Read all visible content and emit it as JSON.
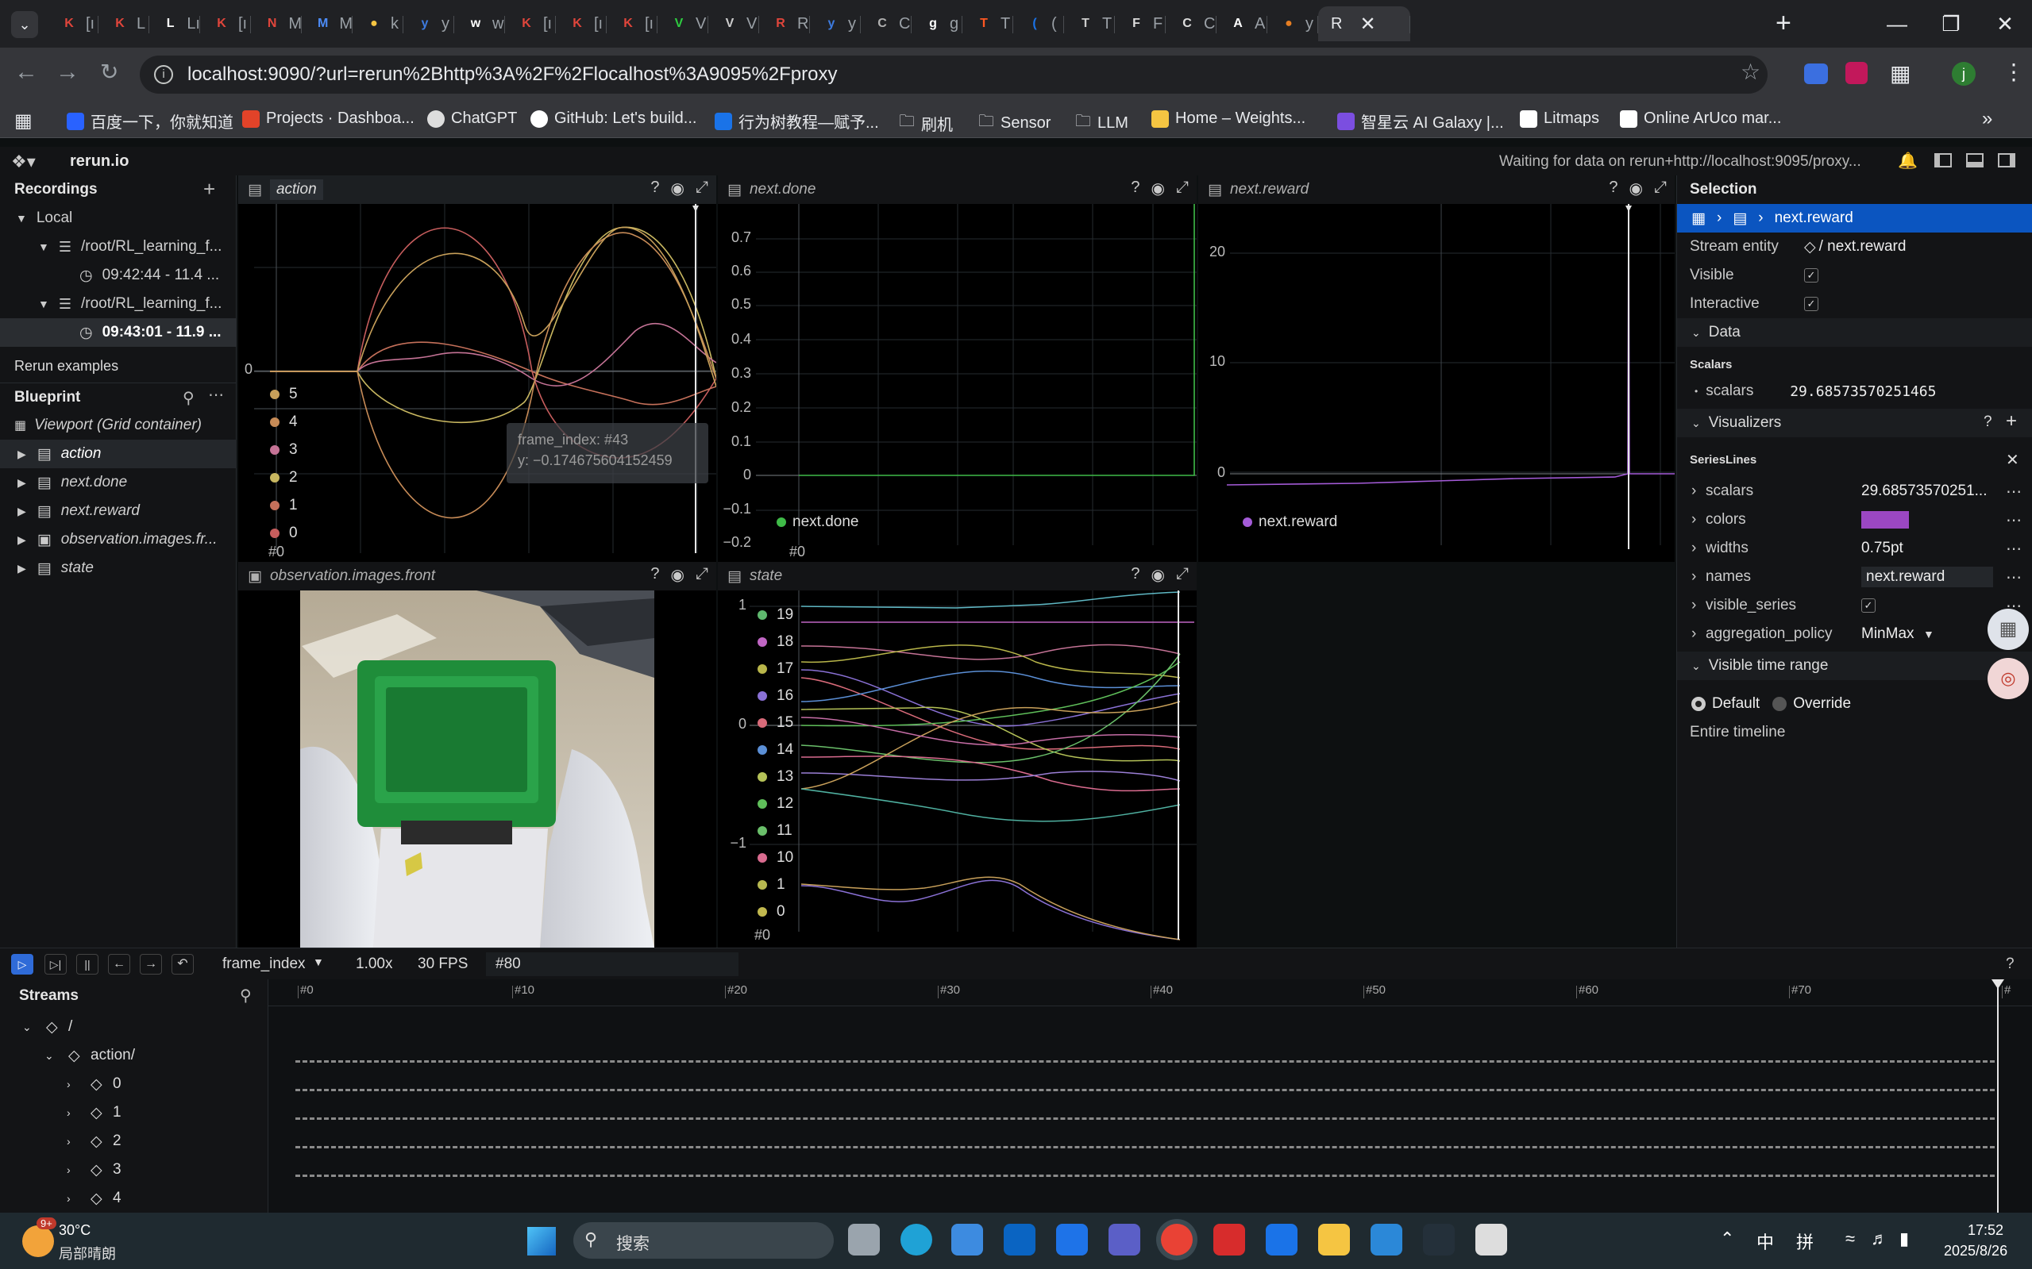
{
  "browser": {
    "tab_glyphs": [
      "K",
      "K",
      "L",
      "K",
      "N",
      "M",
      "●",
      "y",
      "w",
      "K",
      "K",
      "K",
      "V",
      "V",
      "R",
      "y",
      "C",
      "g",
      "T",
      "(",
      "T",
      "F",
      "C",
      "A",
      "●"
    ],
    "tab_titles": [
      "[ı",
      "L",
      "Lı",
      "[ı",
      "M",
      "M",
      "k",
      "y",
      "w",
      "[ı",
      "[ı",
      "[ı",
      "V",
      "V",
      "R",
      "y",
      "C",
      "g",
      "T",
      "(",
      "T",
      "F",
      "C",
      "A",
      "y"
    ],
    "tab_colors": [
      "#e0453b",
      "#e0453b",
      "#ffffff",
      "#e0453b",
      "#e0453b",
      "#4c8bf5",
      "#f5c542",
      "#3d7be0",
      "#ffffff",
      "#e0453b",
      "#e0453b",
      "#e0453b",
      "#2ecc40",
      "#cccccc",
      "#e0453b",
      "#3d7be0",
      "#b0b0b0",
      "#ffffff",
      "#ff5722",
      "#1a73e8",
      "#cccccc",
      "#dddddd",
      "#dddddd",
      "#ffffff",
      "#e67e22"
    ],
    "active_tab_title": "R",
    "url": "localhost:9090/?url=rerun%2Bhttp%3A%2F%2Flocalhost%3A9095%2Fproxy",
    "profile_initial": "j",
    "bookmarks": [
      "百度一下，你就知道",
      "Projects · Dashboa...",
      "ChatGPT",
      "GitHub: Let's build...",
      "行为树教程—赋予...",
      "刷机",
      "Sensor",
      "LLM",
      "Home – Weights...",
      "智星云 AI Galaxy |...",
      "Litmaps",
      "Online ArUco mar..."
    ]
  },
  "app": {
    "brand": "rerun.io",
    "status": "Waiting for data on rerun+http://localhost:9095/proxy..."
  },
  "recordings": {
    "title": "Recordings",
    "local": "Local",
    "items": [
      {
        "path": "/root/RL_learning_f...",
        "time": "09:42:44 - 11.4 ..."
      },
      {
        "path": "/root/RL_learning_f...",
        "time": "09:43:01 - 11.9 ..."
      }
    ],
    "examples": "Rerun examples"
  },
  "blueprint": {
    "title": "Blueprint",
    "viewport": "Viewport (Grid container)",
    "items": [
      "action",
      "next.done",
      "next.reward",
      "observation.images.fr...",
      "state"
    ]
  },
  "views": {
    "action": {
      "title": "action",
      "legend": [
        "5",
        "4",
        "3",
        "2",
        "1",
        "0"
      ],
      "legend_colors": [
        "#c8a05a",
        "#c78b57",
        "#c57396",
        "#c8b760",
        "#c5705a",
        "#c65d5d"
      ],
      "ytick": "0",
      "xtick": "#0",
      "tooltip_frame": "frame_index: #43",
      "tooltip_y": "y: −0.174675604152459"
    },
    "next_done": {
      "title": "next.done",
      "yticks": [
        "0.7",
        "0.6",
        "0.5",
        "0.4",
        "0.3",
        "0.2",
        "0.1",
        "0",
        "−0.1",
        "−0.2"
      ],
      "xtick": "#0",
      "legend": "next.done",
      "color": "#3fbb48"
    },
    "next_reward": {
      "title": "next.reward",
      "yticks": [
        "20",
        "10",
        "0"
      ],
      "legend": "next.reward",
      "color": "#a45bd8"
    },
    "observation": {
      "title": "observation.images.front"
    },
    "state": {
      "title": "state",
      "yticks": [
        "1",
        "0",
        "−1"
      ],
      "xtick": "#0",
      "legend": [
        "19",
        "18",
        "17",
        "16",
        "15",
        "14",
        "13",
        "12",
        "11",
        "10",
        "1",
        "0"
      ],
      "legend_colors": [
        "#5fb86e",
        "#c066c4",
        "#b9b64a",
        "#8a71d6",
        "#d96b7a",
        "#5b8fd6",
        "#b5c258",
        "#5fbf5a",
        "#6abf6a",
        "#d96b8f",
        "#b7b850",
        "#c1b84e"
      ]
    }
  },
  "selection": {
    "title": "Selection",
    "breadcrumb": "next.reward",
    "stream_entity_label": "Stream entity",
    "stream_entity_value": "/ next.reward",
    "visible_label": "Visible",
    "interactive_label": "Interactive",
    "data_label": "Data",
    "scalars_header": "Scalars",
    "scalars_label": "scalars",
    "scalars_value": "29.68573570251465",
    "visualizers_label": "Visualizers",
    "serieslines": "SeriesLines",
    "props": [
      {
        "name": "scalars",
        "value": "29.68573570251..."
      },
      {
        "name": "colors",
        "value": ""
      },
      {
        "name": "widths",
        "value": "0.75pt"
      },
      {
        "name": "names",
        "value": "next.reward"
      },
      {
        "name": "visible_series",
        "value": "✓"
      },
      {
        "name": "aggregation_policy",
        "value": "MinMax"
      }
    ],
    "color_swatch": "#9b47c2",
    "time_range_label": "Visible time range",
    "default_label": "Default",
    "override_label": "Override",
    "entire_timeline": "Entire timeline"
  },
  "timeline": {
    "timeline_name": "frame_index",
    "speed": "1.00x",
    "fps": "30 FPS",
    "frame": "#80",
    "ticks": [
      "#0",
      "#10",
      "#20",
      "#30",
      "#40",
      "#50",
      "#60",
      "#70",
      "#"
    ],
    "streams_title": "Streams",
    "tree": [
      {
        "label": "/",
        "indent": 0
      },
      {
        "label": "action/",
        "indent": 1
      },
      {
        "label": "0",
        "indent": 2
      },
      {
        "label": "1",
        "indent": 2
      },
      {
        "label": "2",
        "indent": 2
      },
      {
        "label": "3",
        "indent": 2
      },
      {
        "label": "4",
        "indent": 2
      }
    ]
  },
  "taskbar": {
    "badge": "9+",
    "weather_temp": "30°C",
    "weather_text": "局部晴朗",
    "search": "搜索",
    "ime1": "中",
    "ime2": "拼",
    "time": "17:52",
    "date": "2025/8/26"
  }
}
